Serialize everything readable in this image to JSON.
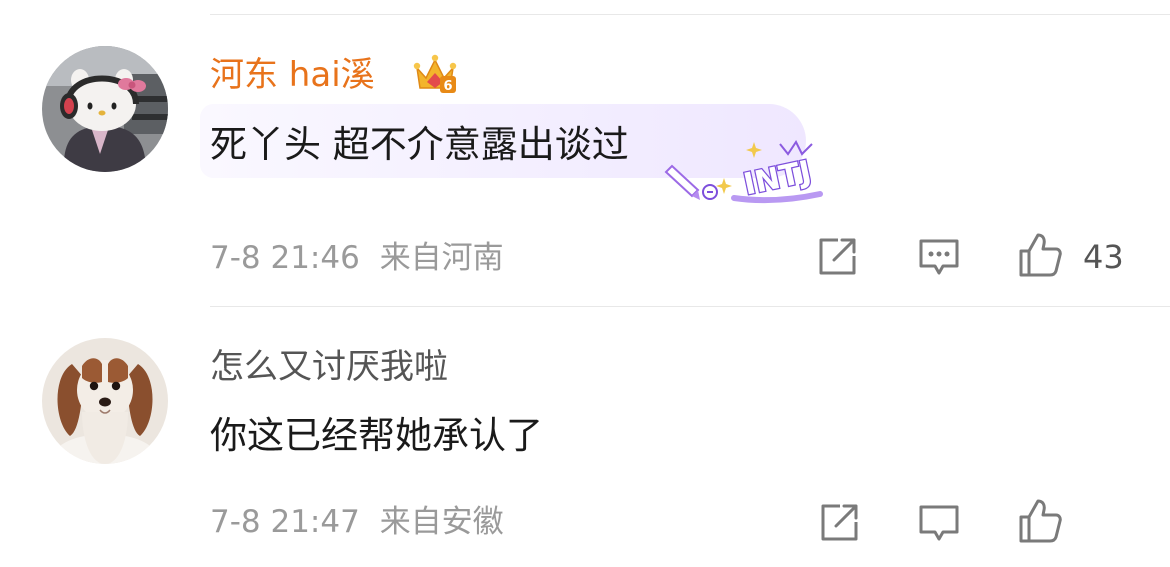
{
  "comments": [
    {
      "user": "河东 hai溪",
      "text": "死丫头 超不介意露出谈过",
      "time": "7-8 21:46",
      "location": "来自河南",
      "likes": "43",
      "badge_label": "6",
      "tag": "INTJ",
      "username_color": "#e8731b"
    },
    {
      "user": "怎么又讨厌我啦",
      "text": "你这已经帮她承认了",
      "time": "7-8 21:47",
      "location": "来自安徽"
    }
  ],
  "icons": {
    "share": "share-icon",
    "comment": "comment-icon",
    "like": "thumbs-up-icon",
    "crown": "crown-badge-icon",
    "mbti": "mbti-sticker"
  }
}
